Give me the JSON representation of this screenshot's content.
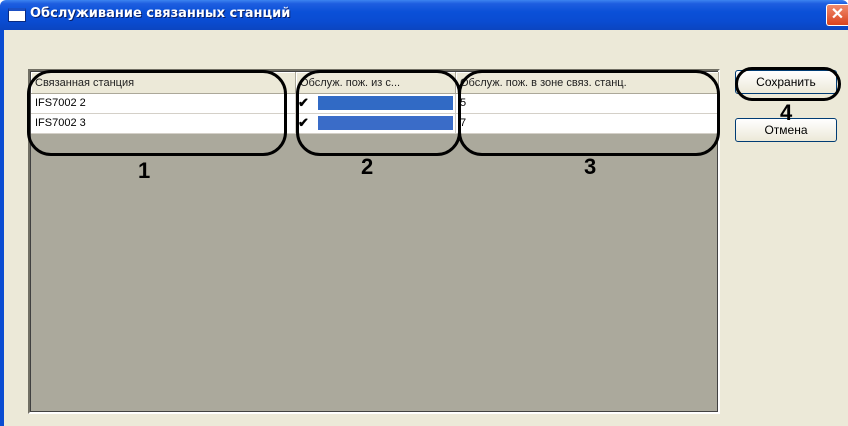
{
  "window": {
    "title": "Обслуживание связанных станций",
    "close_label": "✕"
  },
  "grid": {
    "columns": [
      "Связанная станция",
      "Обслуж. пож. из с...",
      "Обслуж. пож. в зоне связ. станц."
    ],
    "rows": [
      {
        "station": "IFS7002 2",
        "checked": true,
        "check_glyph": "✔",
        "zone_value": "5"
      },
      {
        "station": "IFS7002 3",
        "checked": true,
        "check_glyph": "✔",
        "zone_value": "7"
      }
    ]
  },
  "buttons": {
    "save_label": "Сохранить",
    "cancel_label": "Отмена"
  },
  "callouts": [
    "1",
    "2",
    "3",
    "4"
  ],
  "colors": {
    "titlebar": "#0a4cd2",
    "dialog_bg": "#ece9d8",
    "grid_bg": "#aba99c",
    "selection": "#316ac5"
  }
}
